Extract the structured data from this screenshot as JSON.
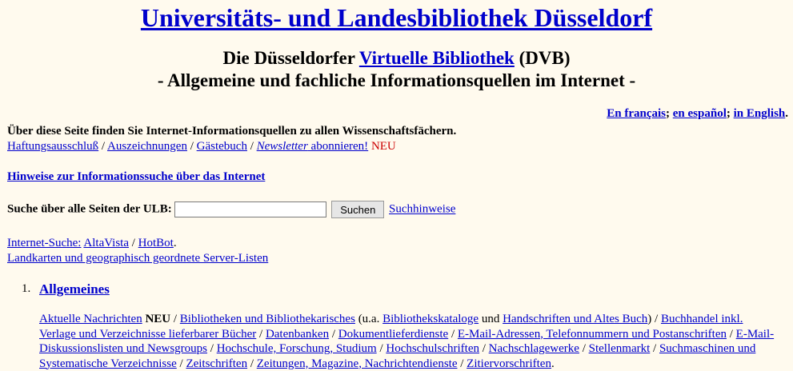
{
  "header": {
    "title": "Universitäts- und Landesbibliothek Düsseldorf",
    "subtitle_prefix": "Die Düsseldorfer ",
    "subtitle_link": "Virtuelle Bibliothek",
    "subtitle_suffix": " (DVB)",
    "tagline": "- Allgemeine und fachliche Informationsquellen im Internet -"
  },
  "languages": {
    "fr": "En français",
    "sep1": "; ",
    "es": "en español",
    "sep2": "; ",
    "en": "in English",
    "end": "."
  },
  "intro": "Über diese Seite finden Sie Internet-Informationsquellen zu allen Wissenschaftsfächern.",
  "toplinks": {
    "haftung": "Haftungsausschluß",
    "sep": " / ",
    "auszeichnungen": "Auszeichnungen",
    "gaestebuch": "Gästebuch",
    "newsletter": "Newsletter",
    "abonnieren": " abonnieren!",
    "neu": "NEU"
  },
  "hinweise": "Hinweise zur Informationssuche über das Internet",
  "search": {
    "label": "Suche über alle Seiten der ULB:",
    "value": "",
    "button": "Suchen",
    "help": "Suchhinweise"
  },
  "internet": {
    "label": "Internet-Suche:",
    "altavista": "AltaVista",
    "sep": " / ",
    "hotbot": "HotBot",
    "end": ".",
    "landkarten": "Landkarten und geographisch geordnete Server-Listen"
  },
  "section": {
    "number": "1.",
    "title": "Allgemeines",
    "items": {
      "nachrichten": "Aktuelle Nachrichten",
      "neu": "NEU",
      "bibliotheken": "Bibliotheken und Bibliothekarisches",
      "ua": " (u.a. ",
      "kataloge": "Bibliothekskataloge",
      "und": " und ",
      "handschriften": "Handschriften und Altes Buch",
      "close": ")",
      "buchhandel": "Buchhandel inkl. Verlage und Verzeichnisse lieferbarer Bücher",
      "datenbanken": "Datenbanken",
      "dokument": "Dokumentlieferdienste",
      "email": "E-Mail-Adressen, Telefonnummern und Postanschriften",
      "diskussion": "E-Mail-Diskussionslisten und Newsgroups",
      "hochschule": "Hochschule, Forschung, Studium",
      "hochschulschriften": "Hochschulschriften",
      "nachschlage": "Nachschlagewerke",
      "stellenmarkt": "Stellenmarkt",
      "suchmaschinen": "Suchmaschinen und Systematische Verzeichnisse",
      "zeitschriften": "Zeitschriften",
      "zeitungen": "Zeitungen, Magazine, Nachrichtendienste",
      "zitier": "Zitiervorschriften",
      "sep": " / ",
      "end": "."
    }
  }
}
